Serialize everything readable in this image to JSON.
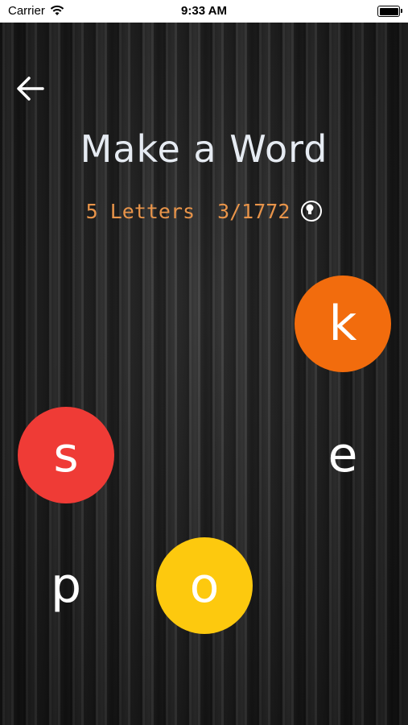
{
  "status_bar": {
    "carrier": "Carrier",
    "time": "9:33 AM"
  },
  "header": {
    "back_icon": "arrow-left-icon",
    "title": "Make a Word",
    "word_length_label": "5 Letters",
    "progress": "3/1772",
    "hint_icon": "lightbulb-icon"
  },
  "colors": {
    "title": "#e6ebf2",
    "subtitle": "#e8944a",
    "letter_k": "#f26c0d",
    "letter_s": "#ef3b36",
    "letter_o": "#fdc90e"
  },
  "letters": [
    {
      "char": "k",
      "highlighted": true,
      "color": "#f26c0d"
    },
    {
      "char": "s",
      "highlighted": true,
      "color": "#ef3b36"
    },
    {
      "char": "e",
      "highlighted": false
    },
    {
      "char": "p",
      "highlighted": false
    },
    {
      "char": "o",
      "highlighted": true,
      "color": "#fdc90e"
    }
  ]
}
